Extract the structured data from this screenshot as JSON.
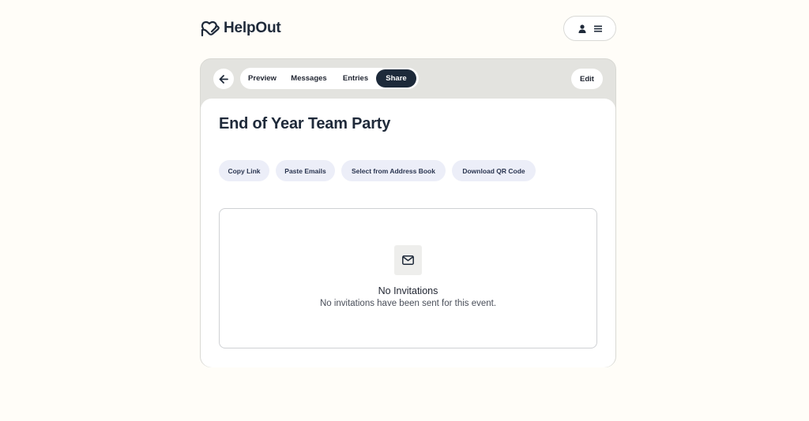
{
  "app": {
    "brand": "HelpOut",
    "logo_icon": "hand-heart-icon",
    "user_icon": "person-icon",
    "menu_icon": "hamburger-menu-icon"
  },
  "nav": {
    "back_icon": "arrow-left-icon",
    "tabs": [
      {
        "label": "Preview"
      },
      {
        "label": "Messages"
      },
      {
        "label": "Entries"
      },
      {
        "label": "Share",
        "active": true
      }
    ],
    "edit_label": "Edit"
  },
  "event": {
    "title": "End of Year Team Party"
  },
  "share_actions": [
    {
      "label": "Copy Link"
    },
    {
      "label": "Paste Emails"
    },
    {
      "label": "Select from Address Book"
    },
    {
      "label": "Download QR Code"
    }
  ],
  "empty_state": {
    "icon": "envelope-icon",
    "title": "No Invitations",
    "description": "No invitations have been sent for this event."
  },
  "colors": {
    "background": "#fffdf8",
    "card_frame": "#e3e3df",
    "active_tab": "#1d2a3a",
    "pill_bg": "#eceef8"
  }
}
